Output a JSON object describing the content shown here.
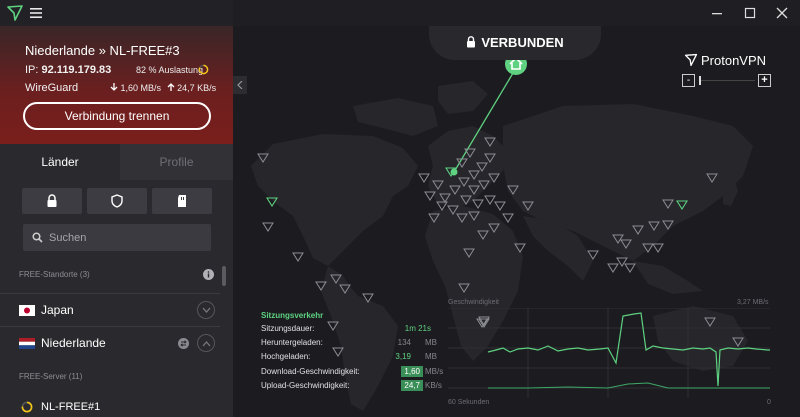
{
  "app": {
    "title": "ProtonVPN",
    "accent": "#5ed281",
    "disconnect_color": "#7a1f1c"
  },
  "window_controls": {
    "minimize": "minimize-icon",
    "maximize": "maximize-icon",
    "close": "close-icon"
  },
  "connection": {
    "title": "Niederlande » NL-FREE#3",
    "ip_label": "IP:",
    "ip": "92.119.179.83",
    "load_text": "82 % Auslastung",
    "load": 0.82,
    "protocol": "WireGuard",
    "down": "1,60 MB/s",
    "up": "24,7 KB/s",
    "disconnect_label": "Verbindung trennen"
  },
  "tabs": {
    "countries": "Länder",
    "profiles": "Profile"
  },
  "filters": [
    "lock-icon",
    "shield-icon",
    "sd-card-icon"
  ],
  "search": {
    "placeholder": "Suchen"
  },
  "sections": {
    "free_locations": "FREE-Standorte (3)",
    "free_servers": "FREE-Server (11)"
  },
  "countries": [
    {
      "name": "Japan",
      "expanded": false
    },
    {
      "name": "Niederlande",
      "expanded": true
    }
  ],
  "servers": [
    {
      "name": "NL-FREE#1"
    }
  ],
  "map": {
    "status": "VERBUNDEN",
    "brand": "ProtonVPN",
    "zoom_out": "-",
    "zoom_in": "+"
  },
  "stats": {
    "title": "Sitzungsverkehr",
    "rows": [
      {
        "label": "Sitzungsdauer:",
        "value": "1m 21s",
        "unit": ""
      },
      {
        "label": "Heruntergeladen:",
        "value": "134",
        "unit": "MB"
      },
      {
        "label": "Hochgeladen:",
        "value": "3,19",
        "unit": "MB"
      },
      {
        "label": "Download-Geschwindigkeit:",
        "value": "1,60",
        "unit": "MB/s"
      },
      {
        "label": "Upload-Geschwindigkeit:",
        "value": "24,7",
        "unit": "KB/s"
      }
    ]
  },
  "graph": {
    "title": "Geschwindigkeit",
    "max_label": "3,27 MB/s",
    "x_left": "60 Sekunden",
    "x_right": "0"
  }
}
